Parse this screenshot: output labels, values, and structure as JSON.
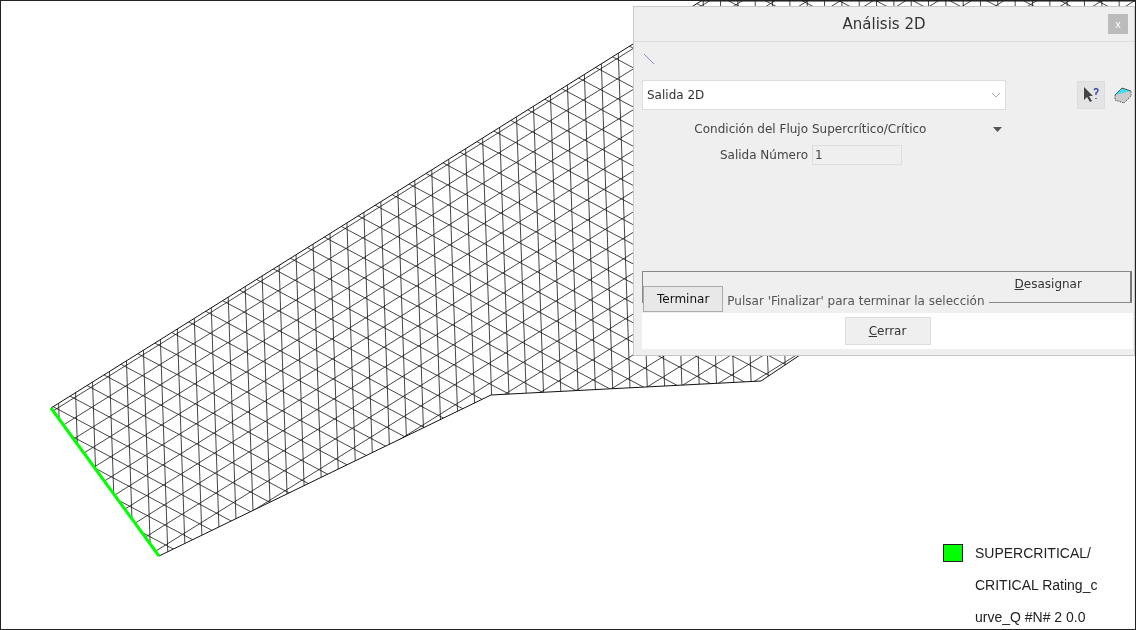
{
  "dialog": {
    "title": "Análisis 2D",
    "close": "x",
    "selector": {
      "value": "Salida 2D"
    },
    "fields": [
      {
        "kind": "dropdown",
        "label": "Condición del Flujo",
        "value": "Supercrítico/Crítico"
      },
      {
        "kind": "input",
        "label": "Salida Número",
        "value": "1"
      }
    ],
    "finish_button": "Terminar",
    "prompt": "Pulsar 'Finalizar' para terminar la selección",
    "unassign_button": "Desasignar",
    "close_button": "Cerrar"
  },
  "legend": {
    "color": "#00ff00",
    "lines": [
      "SUPERCRITICAL/",
      "CRITICAL Rating_c",
      "urve_Q #N# 2 0.0"
    ]
  }
}
